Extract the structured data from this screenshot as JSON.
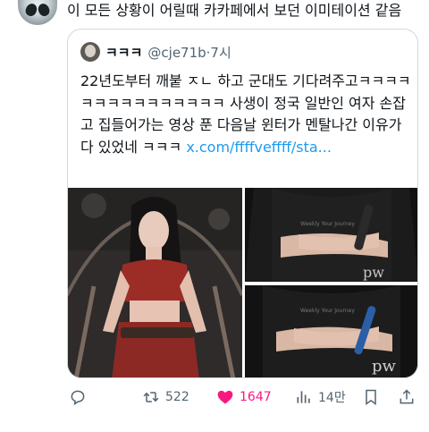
{
  "tweet": {
    "text": "이 모든 상황이 어릴때 카카페에서 보던 이미테이션 같음"
  },
  "quote": {
    "name": "ㅋㅋㅋ",
    "handle_time": "@cje71b·7시",
    "text": "22년도부터 깨붙 ㅈㄴ 하고 군대도 기다려주고ㅋㅋㅋㅋㅋㅋㅋㅋㅋㅋㅋㅋㅋㅋㅋ 사생이 정국 일반인 여자 손잡고 집들어가는 영상 푼 다음날 윈터가 멘탈나간 이유가 다 있었네 ㅋㅋㅋ ",
    "link": "x.com/ffffveffff/sta...",
    "watermark": "pw"
  },
  "actions": {
    "retweets": "522",
    "likes": "1647",
    "views": "14만"
  },
  "colors": {
    "like": "#f91880",
    "link": "#1d9bf0",
    "muted": "#536471"
  }
}
